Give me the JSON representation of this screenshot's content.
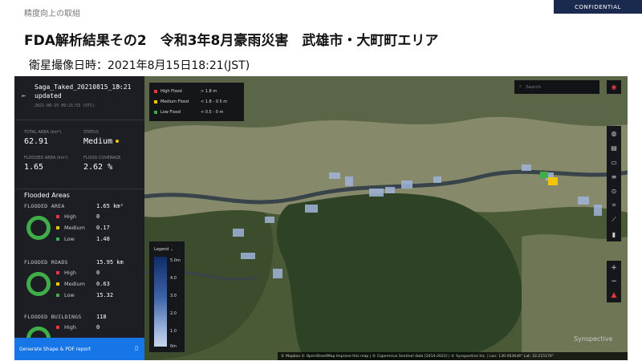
{
  "header": {
    "breadcrumb": "精度向上の取組",
    "confidential": "CONFIDENTIAL",
    "title": "FDA解析結果その2　令和3年8月豪雨災害　武雄市・大町町エリア",
    "subtitle": "衛星撮像日時：2021年8月15日18:21(JST)"
  },
  "sidebar": {
    "project_name": "Saga_Taked_20210815_18:21 updated",
    "date": "2021-08-15 09:21:53 (UTC)",
    "stats": {
      "total_area_label": "TOTAL AREA (km²)",
      "total_area": "62.91",
      "status_label": "STATUS",
      "status": "Medium",
      "flooded_area_label": "FLOODED AREA (km²)",
      "flooded_area": "1.65",
      "flood_coverage_label": "FLOOD COVERAGE",
      "flood_coverage": "2.62 %"
    },
    "flooded_areas_title": "Flooded Areas",
    "sections": [
      {
        "label": "FLOODED AREA",
        "total": "1.65 km²",
        "rows": [
          [
            "High",
            "0"
          ],
          [
            "Medium",
            "0.17"
          ],
          [
            "Low",
            "1.48"
          ]
        ]
      },
      {
        "label": "FLOODED ROADS",
        "total": "15.95 km",
        "rows": [
          [
            "High",
            "0"
          ],
          [
            "Medium",
            "0.63"
          ],
          [
            "Low",
            "15.32"
          ]
        ]
      },
      {
        "label": "FLOODED BUILDINGS",
        "total": "118",
        "rows": [
          [
            "High",
            "0"
          ]
        ]
      }
    ],
    "generate_button": "Generate Shape & PDF report"
  },
  "map": {
    "flood_legend": [
      {
        "name": "High Flood",
        "range": "> 1.8 m",
        "color": "#e23b3b"
      },
      {
        "name": "Medium Flood",
        "range": "< 1.8 - 0.5 m",
        "color": "#f2c500"
      },
      {
        "name": "Low Flood",
        "range": "< 0.5 - 0 m",
        "color": "#3fae49"
      }
    ],
    "search_placeholder": "Search",
    "depth_legend_title": "Legend",
    "depth_ticks": [
      "5.0m",
      "4.0",
      "3.0",
      "2.0",
      "1.0",
      "0m"
    ],
    "attribution": "© Mapbox  © OpenStreetMap  Improve this map  | © Copernicus Sentinel data [2014-2022] | © Synspective Inc. | Lon: 130.063646° Lat: 33.215170°",
    "watermark": "Synspective"
  },
  "colors": {
    "high": "#e23b3b",
    "medium": "#f2c500",
    "low": "#3fae49",
    "accent": "#1676e8"
  }
}
